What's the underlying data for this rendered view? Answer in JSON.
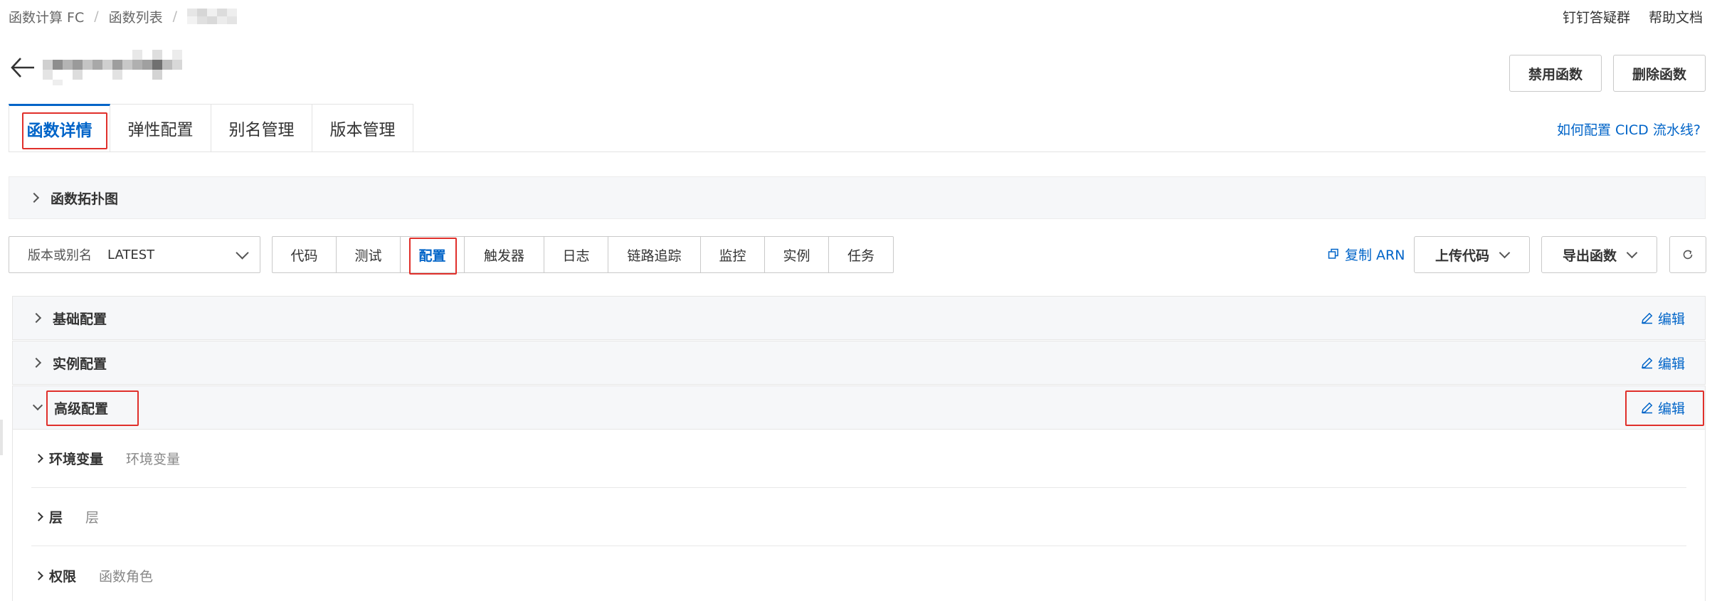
{
  "breadcrumb": {
    "items": [
      "函数计算 FC",
      "函数列表"
    ],
    "separator": "/"
  },
  "top_links": [
    "钉钉答疑群",
    "帮助文档"
  ],
  "header": {
    "disable_label": "禁用函数",
    "delete_label": "删除函数"
  },
  "main_tabs": [
    {
      "label": "函数详情",
      "active": true
    },
    {
      "label": "弹性配置",
      "active": false
    },
    {
      "label": "别名管理",
      "active": false
    },
    {
      "label": "版本管理",
      "active": false
    }
  ],
  "cicd_link": "如何配置 CICD 流水线?",
  "topology": {
    "label": "函数拓扑图"
  },
  "version_select": {
    "label": "版本或别名",
    "value": "LATEST"
  },
  "sub_tabs": [
    {
      "label": "代码",
      "active": false
    },
    {
      "label": "测试",
      "active": false
    },
    {
      "label": "配置",
      "active": true
    },
    {
      "label": "触发器",
      "active": false
    },
    {
      "label": "日志",
      "active": false
    },
    {
      "label": "链路追踪",
      "active": false
    },
    {
      "label": "监控",
      "active": false
    },
    {
      "label": "实例",
      "active": false
    },
    {
      "label": "任务",
      "active": false
    }
  ],
  "actions": {
    "copy_arn": "复制 ARN",
    "upload_code": "上传代码",
    "export_function": "导出函数"
  },
  "panels": {
    "basic": {
      "title": "基础配置",
      "edit": "编辑",
      "expanded": false
    },
    "instance": {
      "title": "实例配置",
      "edit": "编辑",
      "expanded": false
    },
    "advanced": {
      "title": "高级配置",
      "edit": "编辑",
      "expanded": true
    }
  },
  "advanced_rows": [
    {
      "label": "环境变量",
      "desc": "环境变量"
    },
    {
      "label": "层",
      "desc": "层"
    },
    {
      "label": "权限",
      "desc": "函数角色"
    }
  ],
  "colors": {
    "accent": "#0064c8",
    "highlight_box": "#e0302b",
    "panel_bg": "#f6f7f9"
  }
}
